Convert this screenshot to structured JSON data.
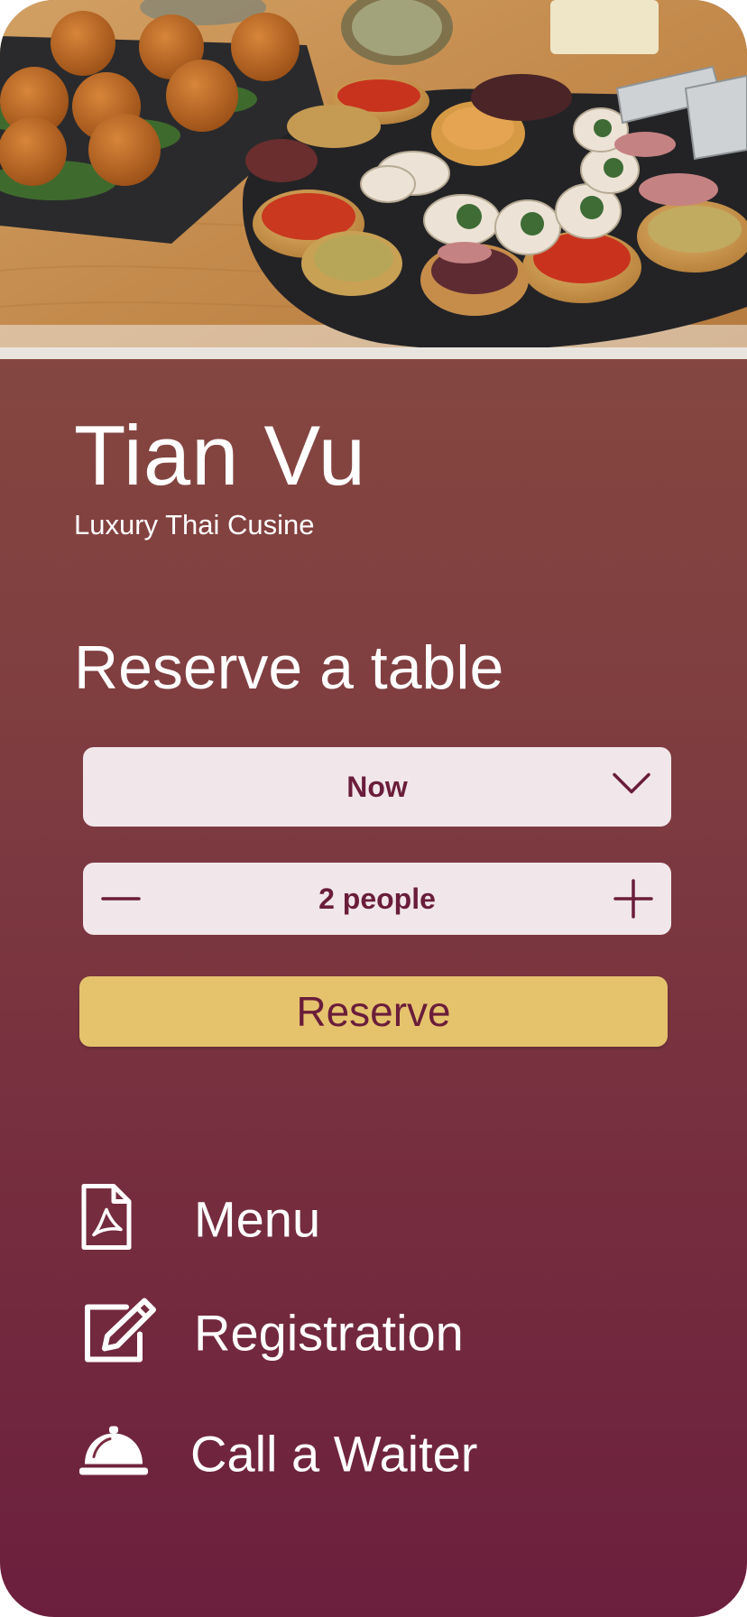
{
  "restaurant": {
    "name": "Tian Vu",
    "tagline": "Luxury Thai Cusine"
  },
  "reservation": {
    "title": "Reserve a table",
    "time": {
      "value": "Now",
      "icon": "chevron-down-icon"
    },
    "party": {
      "count": 2,
      "label": "2 people",
      "decrement_icon": "minus-icon",
      "increment_icon": "plus-icon"
    },
    "submit_label": "Reserve"
  },
  "links": [
    {
      "label": "Menu",
      "icon": "pdf-document-icon"
    },
    {
      "label": "Registration",
      "icon": "edit-icon"
    },
    {
      "label": "Call a Waiter",
      "icon": "service-bell-icon"
    }
  ],
  "colors": {
    "background_top": "#8a5040",
    "background_bottom": "#6c1f3d",
    "field_background": "#f1e7ea",
    "field_text": "#6a1d3a",
    "accent_button": "#e5c36d",
    "text_light": "#ffffff"
  }
}
